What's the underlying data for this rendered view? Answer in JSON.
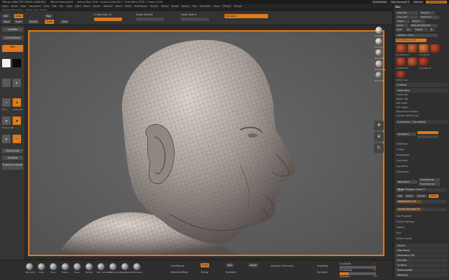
{
  "titlebar": {
    "app": "ZBrush 4R8 [TEST-DEMO-ZBRUSH]",
    "document": "ZBrush Document",
    "stats": "Active Mem 358 • Scratch Disk 827 • Free Mem 3735 • Timer 0.012",
    "quicksave": "QuickSave",
    "see_through": "See-through 0",
    "menus": "Menus",
    "default_zscript": "DefaultZScript"
  },
  "menubar": [
    "Alpha",
    "Brush",
    "Color",
    "Document",
    "Draw",
    "Edit",
    "File",
    "Layer",
    "Light",
    "Macro",
    "Marker",
    "Material",
    "Movie",
    "Picker",
    "Preferences",
    "Render",
    "Stencil",
    "Stroke",
    "Texture",
    "Tool",
    "Transform",
    "Zoom",
    "ZPlugin",
    "ZScript"
  ],
  "status": "Human head sculpt — Move, Scale, Rotate",
  "topshelf": {
    "edit": "Edit",
    "draw": "Draw",
    "move": "Move",
    "scale": "Scale",
    "rotate": "Rotate",
    "intensity": "Z Intensity 25",
    "draw_size": "Draw Size 64",
    "focal": "Focal Shift 0",
    "dynamic": "Dynamic",
    "rgb": "Rgb",
    "zadd": "Zadd",
    "zsub": "Zsub"
  },
  "left": {
    "lightbox": "LightBox",
    "live_boolean": "Live Boolean",
    "note": "BPR",
    "mirror": "Mirror",
    "snapshot": "SnapShot",
    "dots": "Dots",
    "alpha_off": "Alpha Off",
    "texture_off": "Texture Off",
    "spotlight": "SpotLight",
    "switch_color": "SwitchColor",
    "gradient": "Gradient",
    "projection_master": "Projection Master"
  },
  "toolstrip": {
    "materials": [
      "MatCap",
      "MatCap",
      "BasicMat",
      "SkinShade",
      "BasicMat"
    ]
  },
  "rightpanel": {
    "title": "Tool",
    "load_tool": "Load Tool",
    "save_as": "Save As",
    "copy_tool": "Copy Tool",
    "paste_tool": "Paste Tool",
    "import": "Import",
    "export": "Export",
    "clone": "Clone",
    "make_polymesh": "Make PolyMesh3D",
    "goz": "GoZ",
    "all": "All",
    "visible": "Visible",
    "r": "R",
    "lightbox_tools": "Lightbox › Tools",
    "tool_name": "BrushModel_4.48",
    "thumbs": [
      "BrushModel_4",
      "Cylinder3D",
      "PolyMesh3D",
      "SimpleBrush",
      "PM3D_Head"
    ],
    "subtool": "Subtool",
    "geometry": "Geometry",
    "geo_rows": [
      "Lower Res",
      "Higher Res",
      "Del Lower",
      "Del Higher",
      "Reconstruct Subdiv",
      "Convert BPR To Geo"
    ],
    "dynamesh_header": "ArrayMesh / DynaMesh",
    "dynamesh": "DynaMesh",
    "items": [
      "EdgeLoop",
      "Crease",
      "ShadowBox",
      "ClayPolish",
      "DynaMesh",
      "ZRemesher"
    ],
    "zremesher_btn": "ZRemesher",
    "freeze_border": "FreezeBorder",
    "freeze_groups": "FreezeGroups",
    "target_polycount": "Target Polygons Count 5",
    "half": "Half",
    "same": "Same",
    "double": "Double",
    "adapt": "Adapt",
    "adaptive_size": "AdaptiveSize 50",
    "curves_strength": "Curves Strength 50",
    "use_polypaint": "Use Polypaint",
    "modify_topology": "Modify Topology",
    "position": "Position",
    "size": "Size",
    "mesh_integrity": "MeshIntegrity",
    "sections": [
      "Layers",
      "FiberMesh",
      "Geometry HD",
      "Preview",
      "Surface",
      "Deformation",
      "Masking"
    ]
  },
  "bottom": {
    "brushes": [
      "Standard",
      "Inflat",
      "Pinch",
      "Flatten",
      "Move",
      "hPolish",
      "Dam_Standard",
      "TrimDynamic",
      "ClayBuildup",
      "ZModeler"
    ],
    "lazy_mouse": "LazyMouse",
    "backface": "BackfaceMask",
    "poly_f": "PolyF",
    "transp": "Transp",
    "solo": "Solo",
    "xpose": "Xpose",
    "dynamic": "Dynamic",
    "activate_symmetry": "Activate Symmetry",
    "draw_size_label": "DrawSize",
    "dynamic_label": "Dynamic",
    "focal_label": "FocalShift",
    "z_intensity": "Z Intensity",
    "rgb_intensity": "RGB Intensity",
    "strength": "Strength",
    "values": {
      "focal": "0",
      "z": "25",
      "rgb": "100",
      "strength": "100"
    }
  },
  "colors": {
    "accent": "#e07a18",
    "bg": "#2b2b2b",
    "viewport": "#5f5f5f"
  }
}
